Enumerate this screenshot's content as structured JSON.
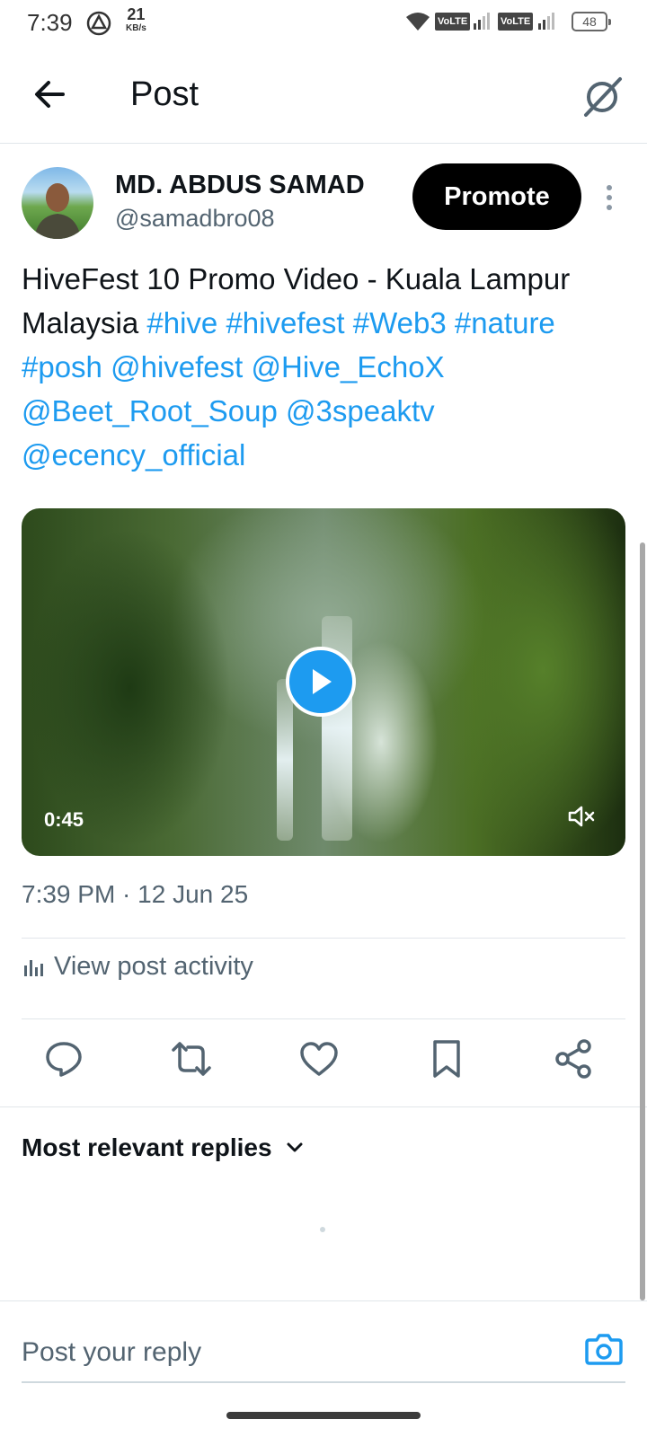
{
  "status_bar": {
    "time": "7:39",
    "net_speed_value": "21",
    "net_speed_unit": "KB/s",
    "volte_1": "VoLTE",
    "volte_2": "VoLTE",
    "battery": "48"
  },
  "header": {
    "title": "Post",
    "back_icon": "arrow-left-icon",
    "grok_icon": "grok-icon"
  },
  "post": {
    "author_name": "MD. ABDUS SAMAD",
    "author_handle": "@samadbro08",
    "promote_label": "Promote",
    "text_plain": "HiveFest 10 Promo Video - Kuala Lampur Malaysia ",
    "text_links": [
      "#hive",
      "#hivefest",
      "#Web3",
      "#nature",
      "#posh",
      "@hivefest",
      "@Hive_EchoX",
      "@Beet_Root_Soup",
      "@3speaktv",
      "@ecency_official"
    ],
    "video_duration": "0:45",
    "timestamp": "7:39 PM · 12 Jun 25",
    "activity_label": "View post activity"
  },
  "actions": [
    "reply-icon",
    "repost-icon",
    "like-icon",
    "bookmark-icon",
    "share-icon"
  ],
  "replies": {
    "sort_label": "Most relevant replies"
  },
  "reply_box": {
    "placeholder": "Post your reply"
  },
  "colors": {
    "link": "#1d9bf0",
    "text": "#0f1419",
    "secondary": "#536471"
  }
}
